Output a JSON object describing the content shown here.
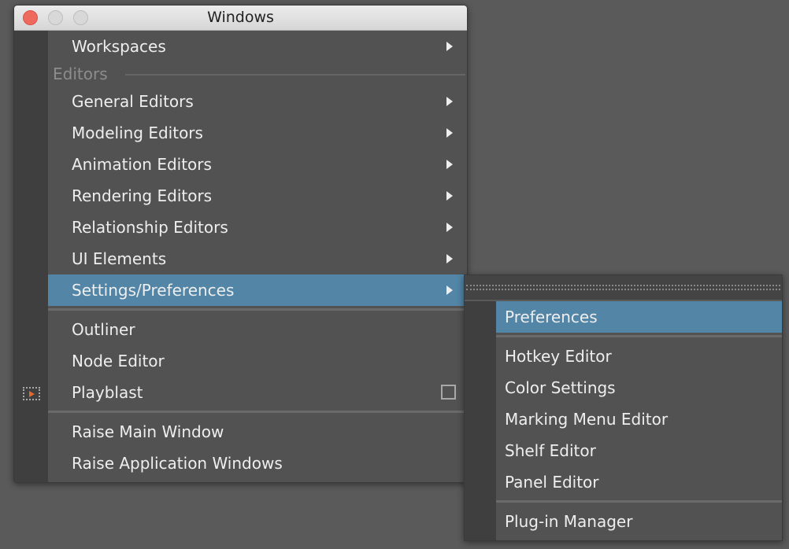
{
  "window": {
    "title": "Windows"
  },
  "menu": {
    "workspaces": "Workspaces",
    "section_editors": "Editors",
    "general_editors": "General Editors",
    "modeling_editors": "Modeling Editors",
    "animation_editors": "Animation Editors",
    "rendering_editors": "Rendering Editors",
    "relationship_editors": "Relationship Editors",
    "ui_elements": "UI Elements",
    "settings_preferences": "Settings/Preferences",
    "outliner": "Outliner",
    "node_editor": "Node Editor",
    "playblast": "Playblast",
    "raise_main_window": "Raise Main Window",
    "raise_application_windows": "Raise Application Windows"
  },
  "submenu": {
    "preferences": "Preferences",
    "hotkey_editor": "Hotkey Editor",
    "color_settings": "Color Settings",
    "marking_menu_editor": "Marking Menu Editor",
    "shelf_editor": "Shelf Editor",
    "panel_editor": "Panel Editor",
    "plugin_manager": "Plug-in Manager"
  },
  "colors": {
    "highlight": "#5285a6",
    "background": "#525252",
    "close": "#ef6a5e"
  }
}
